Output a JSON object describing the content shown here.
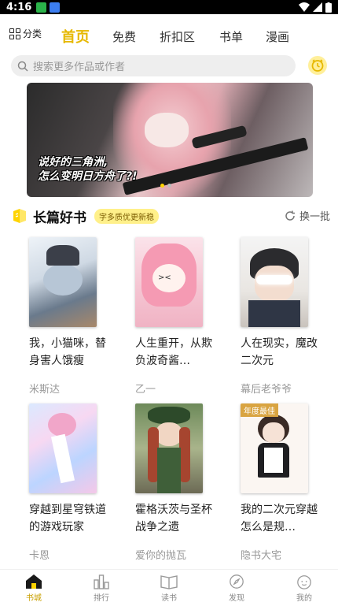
{
  "status_bar": {
    "time": "4:16"
  },
  "topnav": {
    "category_label": "分类",
    "tabs": [
      {
        "label": "首页",
        "active": true
      },
      {
        "label": "免费"
      },
      {
        "label": "折扣区"
      },
      {
        "label": "书单"
      },
      {
        "label": "漫画"
      }
    ]
  },
  "search": {
    "placeholder": "搜索更多作品或作者"
  },
  "banner": {
    "caption_line1": "说好的三角洲,",
    "caption_line2": "怎么变明日方舟了?!"
  },
  "section": {
    "title": "长篇好书",
    "badge": "字多质优更新稳",
    "refresh_label": "换一批"
  },
  "books": [
    {
      "title": "我，小猫咪，替身害人饿瘦",
      "author": "米斯达"
    },
    {
      "title": "人生重开，从欺负波奇酱…",
      "author": "乙一"
    },
    {
      "title": "人在现实，魔改二次元",
      "author": "幕后老爷爷"
    },
    {
      "title": "穿越到星穹铁道的游戏玩家",
      "author": "卡恩"
    },
    {
      "title": "霍格沃茨与圣杯战争之遗",
      "author": "爱你的抛瓦"
    },
    {
      "title": "我的二次元穿越怎么是规…",
      "author": "隐书大宅",
      "tag": "年度最佳"
    }
  ],
  "bottom_nav": [
    {
      "label": "书城",
      "active": true
    },
    {
      "label": "排行"
    },
    {
      "label": "读书"
    },
    {
      "label": "发现"
    },
    {
      "label": "我的"
    }
  ],
  "colors": {
    "accent": "#e6b800",
    "badge_bg": "#fff08a"
  }
}
